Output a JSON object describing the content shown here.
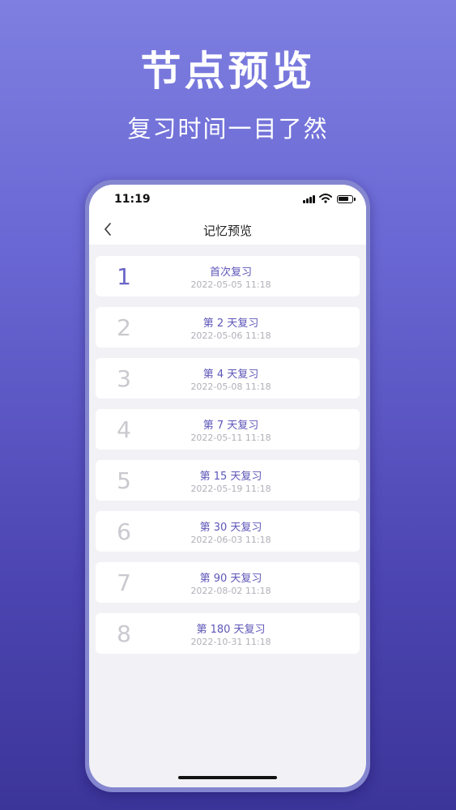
{
  "promo": {
    "headline": "节点预览",
    "subline": "复习时间一目了然"
  },
  "status_bar": {
    "time": "11:19"
  },
  "nav": {
    "title": "记忆预览"
  },
  "items": [
    {
      "index": "1",
      "title": "首次复习",
      "date": "2022-05-05  11:18"
    },
    {
      "index": "2",
      "title": "第 2 天复习",
      "date": "2022-05-06  11:18"
    },
    {
      "index": "3",
      "title": "第 4 天复习",
      "date": "2022-05-08  11:18"
    },
    {
      "index": "4",
      "title": "第 7 天复习",
      "date": "2022-05-11  11:18"
    },
    {
      "index": "5",
      "title": "第 15 天复习",
      "date": "2022-05-19  11:18"
    },
    {
      "index": "6",
      "title": "第 30 天复习",
      "date": "2022-06-03  11:18"
    },
    {
      "index": "7",
      "title": "第 90 天复习",
      "date": "2022-08-02  11:18"
    },
    {
      "index": "8",
      "title": "第 180 天复习",
      "date": "2022-10-31  11:18"
    }
  ],
  "colors": {
    "accent": "#5d56b8",
    "first_index": "#6a65c6",
    "inactive_index": "#c9c9cf",
    "background_top": "#7e7fe0",
    "background_bottom": "#3c3599"
  }
}
